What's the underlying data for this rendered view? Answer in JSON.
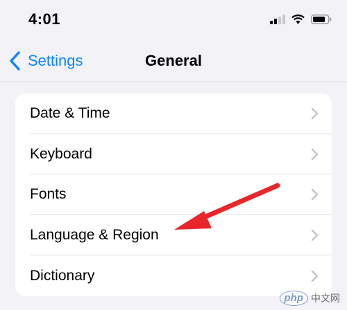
{
  "status_bar": {
    "time": "4:01",
    "icons": [
      "cellular-signal-icon",
      "wifi-icon",
      "battery-icon"
    ]
  },
  "nav": {
    "back_label": "Settings",
    "title": "General"
  },
  "list": {
    "items": [
      {
        "label": "Date & Time"
      },
      {
        "label": "Keyboard"
      },
      {
        "label": "Fonts"
      },
      {
        "label": "Language & Region"
      },
      {
        "label": "Dictionary"
      }
    ]
  },
  "annotation": {
    "arrow_color": "#e8262b",
    "points_to": "Language & Region"
  },
  "watermark": {
    "logo_text": "php",
    "text": "中文网"
  },
  "colors": {
    "accent": "#0a84ff",
    "background": "#f2f2f7",
    "chevron": "#c4c4c7"
  }
}
